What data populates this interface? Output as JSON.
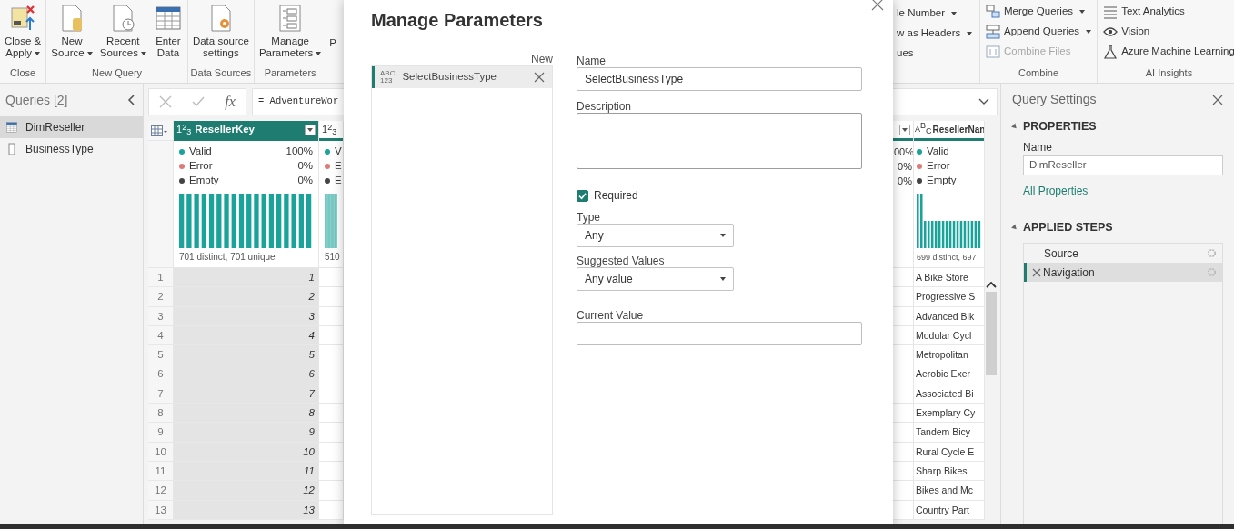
{
  "ribbon": {
    "groups_left": [
      {
        "label": "Close",
        "buttons": [
          {
            "lines": [
              "Close &",
              "Apply"
            ],
            "kind": "close-apply",
            "dropdown": true
          }
        ]
      },
      {
        "label": "New Query",
        "buttons": [
          {
            "lines": [
              "New",
              "Source"
            ],
            "kind": "new-source",
            "dropdown": true
          },
          {
            "lines": [
              "Recent",
              "Sources"
            ],
            "kind": "recent",
            "dropdown": true
          },
          {
            "lines": [
              "Enter",
              "Data"
            ],
            "kind": "table",
            "dropdown": false
          }
        ]
      },
      {
        "label": "Data Sources",
        "buttons": [
          {
            "lines": [
              "Data source",
              "settings"
            ],
            "kind": "datasource",
            "dropdown": false
          }
        ]
      },
      {
        "label": "Parameters",
        "buttons": [
          {
            "lines": [
              "Manage",
              "Parameters"
            ],
            "kind": "manage",
            "dropdown": true
          }
        ]
      }
    ],
    "cut_text": "P",
    "cut_group": {
      "items": [
        {
          "label": "le Number",
          "dropdown": true
        },
        {
          "label": "w as Headers",
          "dropdown": true
        },
        {
          "label": "ues",
          "dropdown": false
        }
      ]
    },
    "groups_right": [
      {
        "label": "Combine",
        "items": [
          {
            "label": "Merge Queries",
            "kind": "merge",
            "dropdown": true,
            "disabled": false
          },
          {
            "label": "Append Queries",
            "kind": "append",
            "dropdown": true,
            "disabled": false
          },
          {
            "label": "Combine Files",
            "kind": "combine",
            "dropdown": false,
            "disabled": true
          }
        ]
      },
      {
        "label": "AI Insights",
        "items": [
          {
            "label": "Text Analytics",
            "kind": "lines",
            "dropdown": false,
            "disabled": false
          },
          {
            "label": "Vision",
            "kind": "eye",
            "dropdown": false,
            "disabled": false
          },
          {
            "label": "Azure Machine Learning",
            "kind": "flask",
            "dropdown": false,
            "disabled": false
          }
        ]
      }
    ]
  },
  "queries": {
    "title": "Queries [2]",
    "items": [
      {
        "label": "DimReseller",
        "kind": "table",
        "selected": true
      },
      {
        "label": "BusinessType",
        "kind": "parameter",
        "selected": false
      }
    ]
  },
  "formula": {
    "fx": "fx",
    "text": "= AdventureWor"
  },
  "grid": {
    "row_numbers": [
      "1",
      "2",
      "3",
      "4",
      "5",
      "6",
      "7",
      "8",
      "9",
      "10",
      "11",
      "12",
      "13"
    ],
    "columns_left": [
      {
        "kind": "number",
        "type": "1$^{2}$$_{3}$",
        "header": "ResellerKey",
        "dropdown": true,
        "selected": true,
        "stats": [
          {
            "label": "Valid",
            "value": "100%",
            "color": "#1aa39a"
          },
          {
            "label": "Error",
            "value": "0%",
            "color": "#e07a7a"
          },
          {
            "label": "Empty",
            "value": "0%",
            "color": "#444444"
          }
        ],
        "footer": "701 distinct, 701 unique",
        "cells": [
          "1",
          "2",
          "3",
          "4",
          "5",
          "6",
          "7",
          "8",
          "9",
          "10",
          "11",
          "12",
          "13"
        ]
      },
      {
        "kind": "number",
        "type": "1$^{2}$$_{3}$",
        "dropdown": false,
        "selected": false,
        "stats": [
          {
            "label": "V",
            "color": "#1aa39a"
          },
          {
            "label": "E",
            "color": "#e07a7a"
          },
          {
            "label": "E",
            "color": "#444444"
          }
        ],
        "footer": "510"
      }
    ],
    "columns_right": [
      {
        "dropdown": true,
        "selected": false,
        "stats": [
          {
            "value": "00%"
          },
          {
            "value": "0%"
          },
          {
            "value": "0%"
          }
        ]
      },
      {
        "kind": "text",
        "type": "A$^{B}$$_{C}$",
        "header": "ResellerNan",
        "selected": false,
        "stats": [
          {
            "label": "Valid",
            "color": "#1aa39a"
          },
          {
            "label": "Error",
            "color": "#e07a7a"
          },
          {
            "label": "Empty",
            "color": "#444444"
          }
        ],
        "footer": "699 distinct, 697",
        "cells": [
          "A Bike Store",
          "Progressive S",
          "Advanced Bik",
          "Modular Cycl",
          "Metropolitan",
          "Aerobic Exer",
          "Associated Bi",
          "Exemplary Cy",
          "Tandem Bicy",
          "Rural Cycle E",
          "Sharp Bikes",
          "Bikes and Mc",
          "Country Part"
        ]
      }
    ]
  },
  "settings": {
    "title": "Query Settings",
    "properties": {
      "heading": "PROPERTIES",
      "name_label": "Name",
      "name_value": "DimReseller",
      "link": "All Properties"
    },
    "steps": {
      "heading": "APPLIED STEPS",
      "items": [
        {
          "label": "Source",
          "selected": false
        },
        {
          "label": "Navigation",
          "selected": true
        }
      ]
    }
  },
  "dialog": {
    "title": "Manage Parameters",
    "new_label": "New",
    "parameters": [
      {
        "type_lines": [
          "ABC",
          "123"
        ],
        "label": "SelectBusinessType",
        "selected": true
      }
    ],
    "form": {
      "name_label": "Name",
      "name_value": "SelectBusinessType",
      "description_label": "Description",
      "required_label": "Required",
      "required": true,
      "type_label": "Type",
      "type_value": "Any",
      "suggested_label": "Suggested Values",
      "suggested_value": "Any value",
      "current_label": "Current Value"
    }
  }
}
